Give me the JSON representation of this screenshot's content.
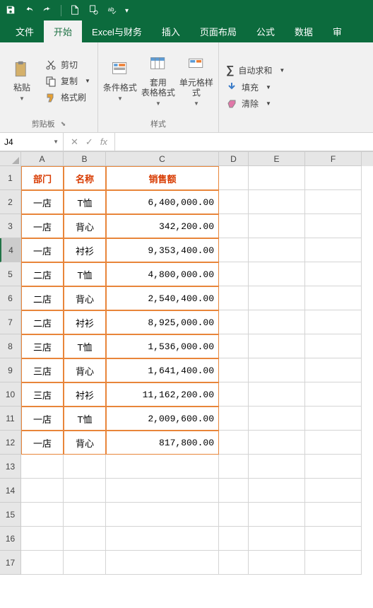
{
  "qat": {
    "items": [
      "save",
      "undo",
      "redo",
      "new-doc",
      "print-preview",
      "spell-check"
    ]
  },
  "tabs": {
    "items": [
      "文件",
      "开始",
      "Excel与财务",
      "插入",
      "页面布局",
      "公式",
      "数据",
      "审"
    ],
    "active": "开始"
  },
  "ribbon": {
    "clipboard": {
      "paste": "粘贴",
      "cut": "剪切",
      "copy": "复制",
      "format_painter": "格式刷",
      "label": "剪贴板"
    },
    "styles": {
      "conditional": "条件格式",
      "table_format": "套用\n表格格式",
      "cell_styles": "单元格样式",
      "label": "样式"
    },
    "editing": {
      "autosum": "自动求和",
      "fill": "填充",
      "clear": "清除"
    }
  },
  "formula_bar": {
    "name_box": "J4",
    "cancel": "✕",
    "enter": "✓",
    "fx": "fx",
    "value": ""
  },
  "grid": {
    "columns": [
      "A",
      "B",
      "C",
      "D",
      "E",
      "F"
    ],
    "headers": [
      "部门",
      "名称",
      "销售额"
    ],
    "rows": [
      {
        "n": 1,
        "a": "部门",
        "b": "名称",
        "c": "销售额",
        "hdr": true
      },
      {
        "n": 2,
        "a": "一店",
        "b": "T恤",
        "c": "6,400,000.00"
      },
      {
        "n": 3,
        "a": "一店",
        "b": "背心",
        "c": "342,200.00"
      },
      {
        "n": 4,
        "a": "一店",
        "b": "衬衫",
        "c": "9,353,400.00",
        "sel": true
      },
      {
        "n": 5,
        "a": "二店",
        "b": "T恤",
        "c": "4,800,000.00"
      },
      {
        "n": 6,
        "a": "二店",
        "b": "背心",
        "c": "2,540,400.00"
      },
      {
        "n": 7,
        "a": "二店",
        "b": "衬衫",
        "c": "8,925,000.00"
      },
      {
        "n": 8,
        "a": "三店",
        "b": "T恤",
        "c": "1,536,000.00"
      },
      {
        "n": 9,
        "a": "三店",
        "b": "背心",
        "c": "1,641,400.00"
      },
      {
        "n": 10,
        "a": "三店",
        "b": "衬衫",
        "c": "11,162,200.00"
      },
      {
        "n": 11,
        "a": "一店",
        "b": "T恤",
        "c": "2,009,600.00"
      },
      {
        "n": 12,
        "a": "一店",
        "b": "背心",
        "c": "817,800.00"
      },
      {
        "n": 13,
        "a": "",
        "b": "",
        "c": ""
      },
      {
        "n": 14,
        "a": "",
        "b": "",
        "c": ""
      },
      {
        "n": 15,
        "a": "",
        "b": "",
        "c": ""
      },
      {
        "n": 16,
        "a": "",
        "b": "",
        "c": ""
      },
      {
        "n": 17,
        "a": "",
        "b": "",
        "c": ""
      }
    ]
  }
}
